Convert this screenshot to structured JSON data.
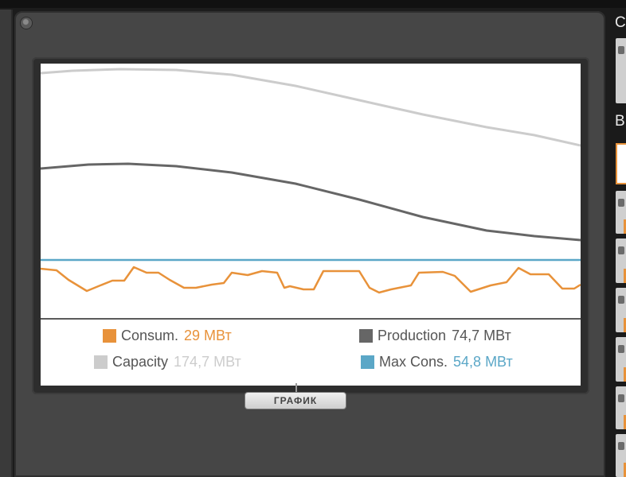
{
  "legend": {
    "consum": {
      "label": "Consum.",
      "value": "29 МВт",
      "color": "#e8923a"
    },
    "production": {
      "label": "Production",
      "value": "74,7 МВт",
      "color": "#666666"
    },
    "capacity": {
      "label": "Capacity",
      "value": "174,7 МВт",
      "color": "#cccccc"
    },
    "max_cons": {
      "label": "Max Cons.",
      "value": "54,8 МВт",
      "color": "#5ba7c7"
    }
  },
  "tab_label": "ГРАФИК",
  "right_panel": {
    "heading_1": "С",
    "heading_2": "В"
  },
  "chart_data": {
    "type": "line",
    "series": [
      {
        "name": "Capacity",
        "color": "#cccccc",
        "values": [
          [
            0,
            12
          ],
          [
            40,
            9
          ],
          [
            100,
            7
          ],
          [
            170,
            8
          ],
          [
            240,
            14
          ],
          [
            320,
            28
          ],
          [
            400,
            46
          ],
          [
            480,
            64
          ],
          [
            560,
            80
          ],
          [
            620,
            90
          ],
          [
            678,
            103
          ]
        ]
      },
      {
        "name": "Production",
        "color": "#666666",
        "values": [
          [
            0,
            132
          ],
          [
            60,
            127
          ],
          [
            110,
            126
          ],
          [
            170,
            129
          ],
          [
            240,
            137
          ],
          [
            320,
            151
          ],
          [
            400,
            171
          ],
          [
            480,
            193
          ],
          [
            560,
            210
          ],
          [
            620,
            217
          ],
          [
            678,
            222
          ]
        ]
      },
      {
        "name": "Max Cons.",
        "color": "#5ba7c7",
        "values": [
          [
            0,
            247
          ],
          [
            678,
            247
          ]
        ]
      },
      {
        "name": "Consum.",
        "color": "#e8923a",
        "values": [
          [
            0,
            258
          ],
          [
            20,
            260
          ],
          [
            35,
            272
          ],
          [
            58,
            286
          ],
          [
            75,
            279
          ],
          [
            90,
            273
          ],
          [
            105,
            273
          ],
          [
            117,
            256
          ],
          [
            133,
            263
          ],
          [
            148,
            263
          ],
          [
            162,
            272
          ],
          [
            180,
            282
          ],
          [
            195,
            282
          ],
          [
            215,
            278
          ],
          [
            230,
            276
          ],
          [
            240,
            263
          ],
          [
            260,
            266
          ],
          [
            278,
            261
          ],
          [
            297,
            263
          ],
          [
            306,
            282
          ],
          [
            313,
            280
          ],
          [
            330,
            284
          ],
          [
            343,
            284
          ],
          [
            355,
            261
          ],
          [
            400,
            261
          ],
          [
            413,
            282
          ],
          [
            425,
            288
          ],
          [
            440,
            284
          ],
          [
            455,
            281
          ],
          [
            465,
            279
          ],
          [
            475,
            263
          ],
          [
            505,
            262
          ],
          [
            520,
            267
          ],
          [
            540,
            287
          ],
          [
            565,
            279
          ],
          [
            585,
            275
          ],
          [
            600,
            257
          ],
          [
            615,
            265
          ],
          [
            638,
            265
          ],
          [
            655,
            283
          ],
          [
            670,
            283
          ],
          [
            678,
            278
          ]
        ]
      }
    ]
  }
}
